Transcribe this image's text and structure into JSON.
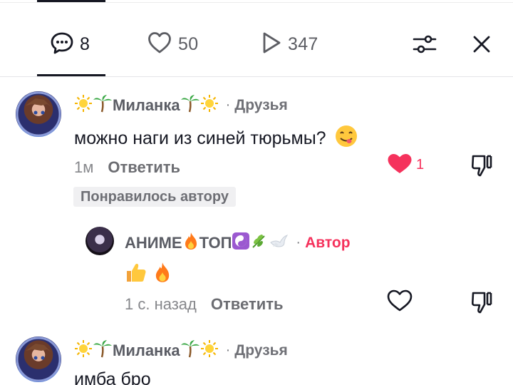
{
  "tabs": {
    "comments_count": "8",
    "likes_count": "50",
    "views_count": "347"
  },
  "comments": [
    {
      "username": "Миланка",
      "username_decoration": "🌞🌴 … 🌴🌞",
      "relation": "Друзья",
      "text": "можно наги из синей тюрьмы?",
      "text_emoji": "😋",
      "time": "1м",
      "reply_label": "Ответить",
      "liked_by_author_label": "Понравилось автору",
      "like_count": "1",
      "liked": true
    }
  ],
  "reply": {
    "username": "АНИМЕ",
    "username_suffix": "ТОП",
    "relation": "Автор",
    "text_emojis": "👍🔥",
    "time": "1 с. назад",
    "reply_label": "Ответить"
  },
  "comment2": {
    "username": "Миланка",
    "relation": "Друзья",
    "text": "имба бро"
  },
  "colors": {
    "accent": "#f5325c",
    "text": "#161823",
    "muted": "#86878b"
  },
  "icons": [
    "comment-icon",
    "heart-icon",
    "play-icon",
    "filter-icon",
    "close-icon",
    "dislike-icon"
  ]
}
